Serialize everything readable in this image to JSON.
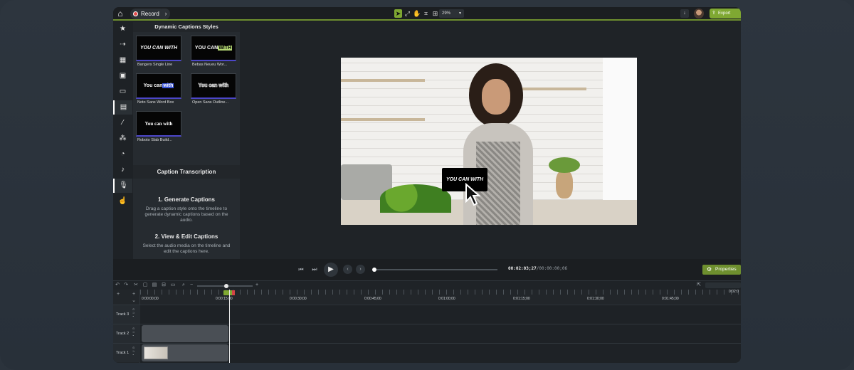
{
  "toolbar": {
    "record_label": "Record",
    "zoom": "29%",
    "export_label": "Export",
    "accent_color": "#7fa832"
  },
  "rail": {
    "items": [
      "star-icon",
      "transitions-icon",
      "media-icon",
      "library-icon",
      "annotations-icon",
      "captions-icon",
      "effects-icon",
      "behaviors-icon",
      "cursor-icon",
      "audio-icon",
      "mic-icon",
      "gesture-icon"
    ]
  },
  "panel": {
    "title": "Dynamic Captions Styles",
    "styles": [
      {
        "preview": "YOU CAN WITH",
        "label": "Bangers Single Line"
      },
      {
        "preview_pre": "YOU CAN ",
        "preview_hl": "WITH",
        "label": "Bebas Neueu Wor..."
      },
      {
        "preview_pre": "You can ",
        "preview_hl": "with",
        "label": "Noto Sans Word Box"
      },
      {
        "preview": "You can with",
        "label": "Open Sans Outline..."
      },
      {
        "preview": "You can with",
        "label": "Roboto Slab Build..."
      }
    ],
    "transcription_title": "Caption Transcription",
    "step1_title": "1. Generate Captions",
    "step1_desc": "Drag a caption style onto the timeline to generate dynamic captions based on the audio.",
    "step2_title": "2. View & Edit Captions",
    "step2_desc": "Select the audio media on the timeline and edit the captions here."
  },
  "canvas": {
    "caption_overlay": "YOU CAN WITH"
  },
  "playback": {
    "timecode_current": "00:02:03;27",
    "timecode_total": "/00:00:00;06",
    "properties_label": "Properties",
    "progress": 0.0
  },
  "timeline": {
    "ticks": [
      "0:00:00;00",
      "0:00:15;00",
      "0:00:30;00",
      "0:00:45;00",
      "0:01:00;00",
      "0:01:15;00",
      "0:01:30;00",
      "0:01:45;00"
    ],
    "end_tick": "0:02:0",
    "tracks": [
      "Track 3",
      "Track 2",
      "Track 1"
    ]
  }
}
